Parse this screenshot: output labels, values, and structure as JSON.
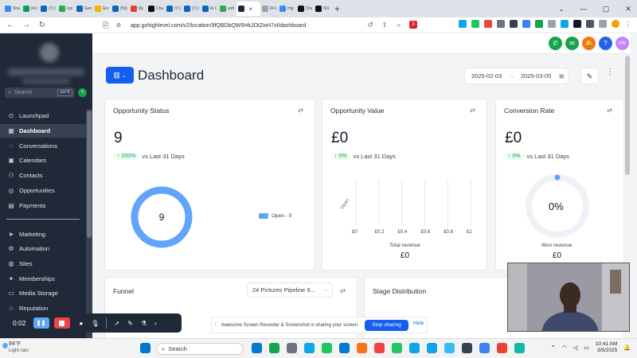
{
  "browser": {
    "tabs": [
      {
        "title": "Sha",
        "color": "#4285f4"
      },
      {
        "title": "(4) I",
        "color": "#0f9d58"
      },
      {
        "title": "(7) L",
        "color": "#0a66c2"
      },
      {
        "title": "Lipi",
        "color": "#34a853"
      },
      {
        "title": "Gen",
        "color": "#0a66c2"
      },
      {
        "title": "Gro",
        "color": "#f4b400"
      },
      {
        "title": "(59)",
        "color": "#0a66c2"
      },
      {
        "title": "My",
        "color": "#db4437"
      },
      {
        "title": "Cha",
        "color": "#111111"
      },
      {
        "title": "(7) L",
        "color": "#0a66c2"
      },
      {
        "title": "(7) L",
        "color": "#0a66c2"
      },
      {
        "title": "AI C",
        "color": "#0a66c2"
      },
      {
        "title": "soft",
        "color": "#34a853"
      },
      {
        "title": "",
        "color": "#1f2937",
        "active": true
      },
      {
        "title": "24 P",
        "color": "#9ca3af"
      },
      {
        "title": "Hig",
        "color": "#4285f4"
      },
      {
        "title": "Cha",
        "color": "#111111"
      },
      {
        "title": "NO",
        "color": "#111111"
      }
    ],
    "url": "app.gohighlevel.com/v2/location/9fQBDbQW5HkJOtZwH7xl/dashboard",
    "badge_count": "3"
  },
  "top_icons": [
    {
      "name": "phone-icon",
      "color": "#16a34a",
      "glyph": "✆"
    },
    {
      "name": "chat-icon",
      "color": "#16a34a",
      "glyph": "✉"
    },
    {
      "name": "bell-icon",
      "color": "#f97316",
      "glyph": "🔔"
    },
    {
      "name": "help-icon",
      "color": "#2563eb",
      "glyph": "?"
    },
    {
      "name": "avatar",
      "color": "#c084fc",
      "glyph": "AW"
    }
  ],
  "sidebar": {
    "search_placeholder": "Search",
    "search_shortcut": "ctrl K",
    "items": [
      {
        "label": "Launchpad",
        "icon": "launchpad-icon",
        "glyph": "⊙"
      },
      {
        "label": "Dashboard",
        "icon": "dashboard-icon",
        "glyph": "▦",
        "active": true
      },
      {
        "label": "Conversations",
        "icon": "chat-icon",
        "glyph": "◌"
      },
      {
        "label": "Calendars",
        "icon": "calendar-icon",
        "glyph": "▣"
      },
      {
        "label": "Contacts",
        "icon": "contacts-icon",
        "glyph": "⚇"
      },
      {
        "label": "Opportunities",
        "icon": "opportunities-icon",
        "glyph": "◎"
      },
      {
        "label": "Payments",
        "icon": "payments-icon",
        "glyph": "▤"
      },
      {
        "label": "Marketing",
        "icon": "marketing-icon",
        "glyph": "➤"
      },
      {
        "label": "Automation",
        "icon": "automation-icon",
        "glyph": "⚙"
      },
      {
        "label": "Sites",
        "icon": "globe-icon",
        "glyph": "◍"
      },
      {
        "label": "Memberships",
        "icon": "memberships-icon",
        "glyph": "✦"
      },
      {
        "label": "Media Storage",
        "icon": "storage-icon",
        "glyph": "▭"
      },
      {
        "label": "Reputation",
        "icon": "star-icon",
        "glyph": "☆"
      }
    ]
  },
  "header": {
    "title": "Dashboard",
    "date_from": "2025-02-03",
    "date_to": "2025-03-05"
  },
  "cards": {
    "status": {
      "title": "Opportunity Status",
      "value": "9",
      "delta": "↑ 200%",
      "compare": "vs Last 31 Days",
      "legend": "Open - 9",
      "center": "9"
    },
    "value": {
      "title": "Opportunity Value",
      "value": "£0",
      "delta": "↑ 0%",
      "compare": "vs Last 31 Days",
      "axis_label": "Total revenue",
      "total": "£0",
      "category": "Open"
    },
    "conversion": {
      "title": "Conversion Rate",
      "value": "£0",
      "delta": "↑ 0%",
      "compare": "vs Last 31 Days",
      "percent": "0%",
      "label": "Won revenue",
      "total": "£0"
    },
    "funnel": {
      "title": "Funnel",
      "pipeline": "24 Pictures Pipeline 9..."
    },
    "stage": {
      "title": "Stage Distribution"
    }
  },
  "chart_data": [
    {
      "type": "pie",
      "title": "Opportunity Status",
      "categories": [
        "Open"
      ],
      "values": [
        9
      ],
      "legend": "right"
    },
    {
      "type": "bar",
      "title": "Opportunity Value",
      "categories": [
        "Open"
      ],
      "values": [
        0
      ],
      "xlabel": "Total revenue",
      "x_ticks": [
        "£0",
        "£0.2",
        "£0.4",
        "£0.6",
        "£0.8",
        "£1"
      ],
      "xlim": [
        0,
        1
      ],
      "grid": true
    },
    {
      "type": "pie",
      "title": "Conversion Rate",
      "categories": [
        "Won revenue"
      ],
      "values": [
        0
      ]
    }
  ],
  "recorder": {
    "time": "0:02"
  },
  "share_notice": {
    "text": "Awesome Screen Recorder & Screenshot is sharing your screen.",
    "stop": "Stop sharing",
    "hide": "Hide"
  },
  "taskbar": {
    "temp": "84°F",
    "weather": "Light rain",
    "search": "Search",
    "time": "10:41 AM",
    "date": "3/5/2025",
    "app_colors": [
      "#0078d4",
      "#16a34a",
      "#6b7280",
      "#0ea5e9",
      "#22c55e",
      "#0078d4",
      "#f97316",
      "#ef4444",
      "#22c55e",
      "#0ea5e9",
      "#0ea5e9",
      "#38bdf8",
      "#374151",
      "#3b82f6",
      "#ea4335",
      "#14b8a6"
    ]
  }
}
